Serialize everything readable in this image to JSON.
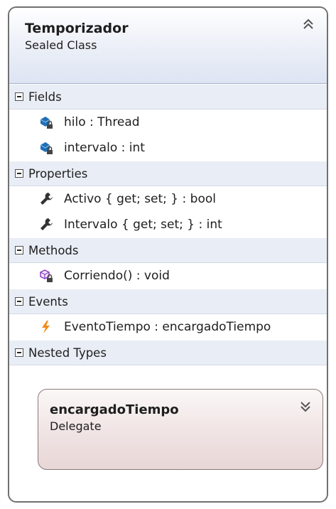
{
  "class": {
    "name": "Temporizador",
    "kind": "Sealed Class",
    "collapse_icon": "double-chevron-up-icon"
  },
  "sections": {
    "fields": {
      "label": "Fields",
      "items": [
        {
          "text": "hilo : Thread",
          "icon": "private-field-icon"
        },
        {
          "text": "intervalo : int",
          "icon": "private-field-icon"
        }
      ]
    },
    "properties": {
      "label": "Properties",
      "items": [
        {
          "text": "Activo { get; set; } : bool",
          "icon": "property-wrench-icon"
        },
        {
          "text": "Intervalo { get; set; } : int",
          "icon": "property-wrench-icon"
        }
      ]
    },
    "methods": {
      "label": "Methods",
      "items": [
        {
          "text": "Corriendo() : void",
          "icon": "private-method-icon"
        }
      ]
    },
    "events": {
      "label": "Events",
      "items": [
        {
          "text": "EventoTiempo : encargadoTiempo",
          "icon": "event-lightning-icon"
        }
      ]
    },
    "nested_types": {
      "label": "Nested Types"
    }
  },
  "nested": {
    "name": "encargadoTiempo",
    "kind": "Delegate",
    "expand_icon": "double-chevron-down-icon"
  },
  "colors": {
    "header_gradient_end": "#dde4f3",
    "section_header_bg": "#e9edf5",
    "field_icon": "#1f6fb5",
    "method_icon": "#8a3fc0",
    "event_icon": "#f28a1a",
    "nested_gradient_end": "#e8d6d6",
    "border": "#707070"
  }
}
